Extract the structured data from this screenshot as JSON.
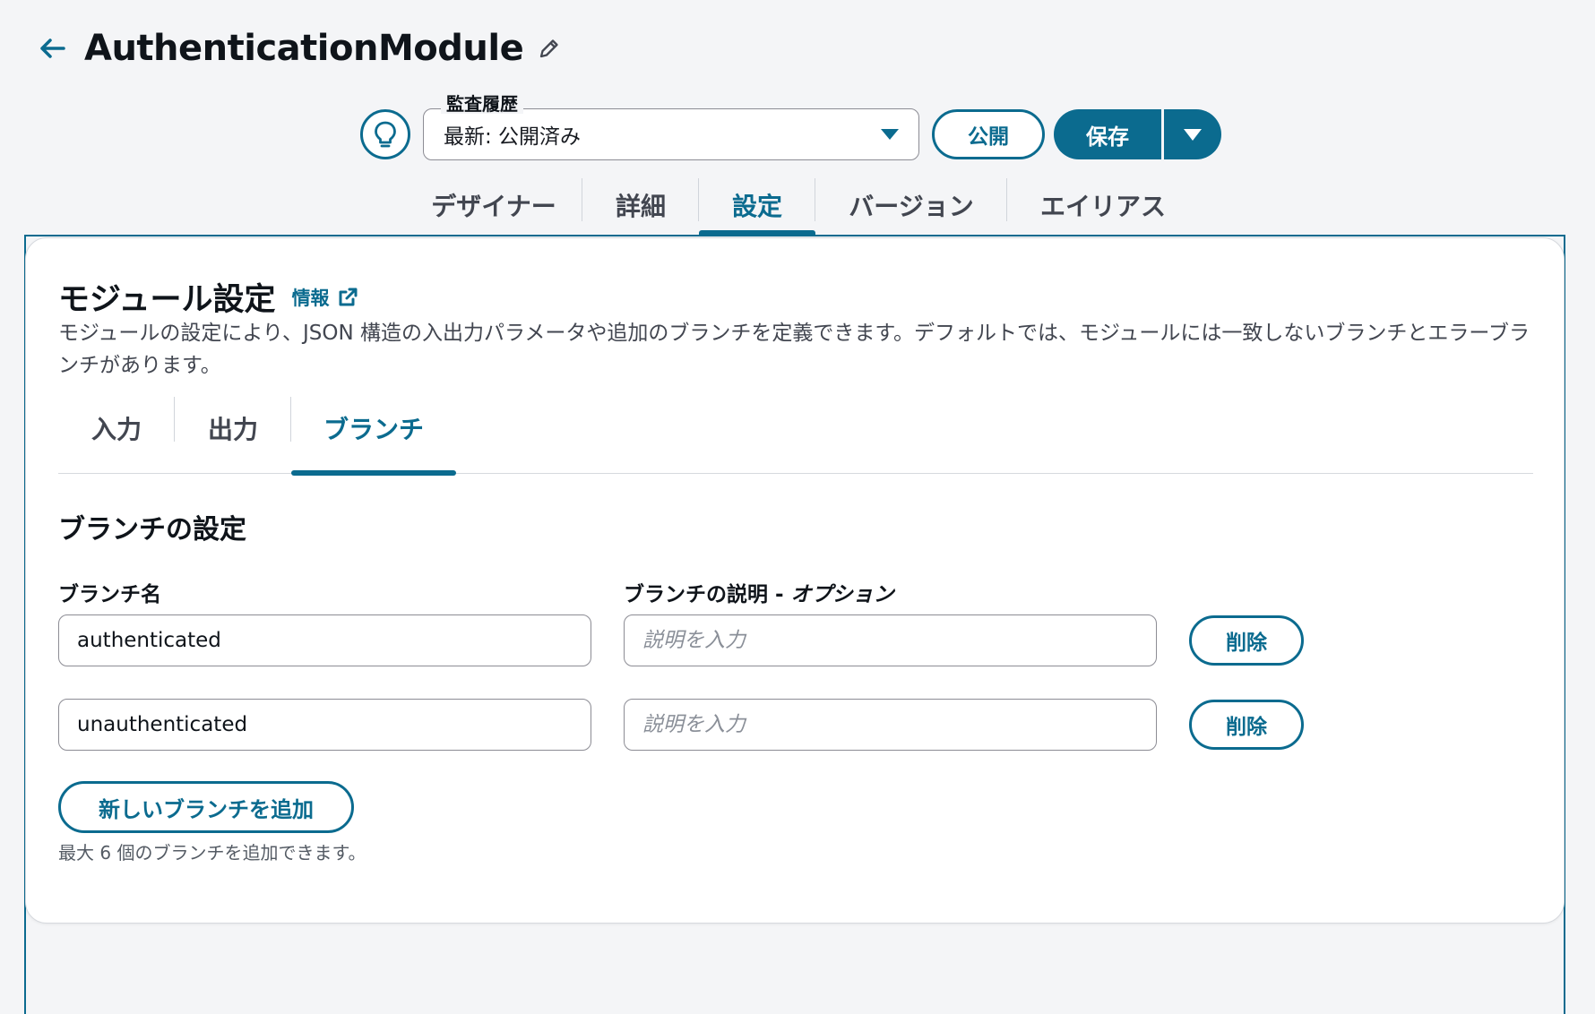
{
  "header": {
    "title": "AuthenticationModule",
    "back_icon": "arrow-left-icon",
    "edit_icon": "pencil-icon"
  },
  "toolbar": {
    "idea_icon": "lightbulb-icon",
    "history_label": "監査履歴",
    "history_value": "最新: 公開済み",
    "publish_label": "公開",
    "save_label": "保存"
  },
  "tabs": [
    {
      "label": "デザイナー"
    },
    {
      "label": "詳細"
    },
    {
      "label": "設定",
      "active": true
    },
    {
      "label": "バージョン"
    },
    {
      "label": "エイリアス"
    }
  ],
  "settings": {
    "title": "モジュール設定",
    "info_link": "情報",
    "description": "モジュールの設定により、JSON 構造の入出力パラメータや追加のブランチを定義できます。デフォルトでは、モジュールには一致しないブランチとエラーブランチがあります。",
    "sub_tabs": [
      {
        "label": "入力"
      },
      {
        "label": "出力"
      },
      {
        "label": "ブランチ",
        "active": true
      }
    ],
    "section_title": "ブランチの設定",
    "branch_name_label": "ブランチ名",
    "branch_desc_label": "ブランチの説明 - ",
    "branch_desc_optional": "オプション",
    "branches": [
      {
        "name": "authenticated",
        "description_placeholder": "説明を入力",
        "delete_label": "削除"
      },
      {
        "name": "unauthenticated",
        "description_placeholder": "説明を入力",
        "delete_label": "削除"
      }
    ],
    "add_branch_label": "新しいブランチを追加",
    "hint": "最大 6 個のブランチを追加できます。"
  },
  "colors": {
    "accent": "#0b6b8f",
    "background": "#f4f5f7"
  }
}
